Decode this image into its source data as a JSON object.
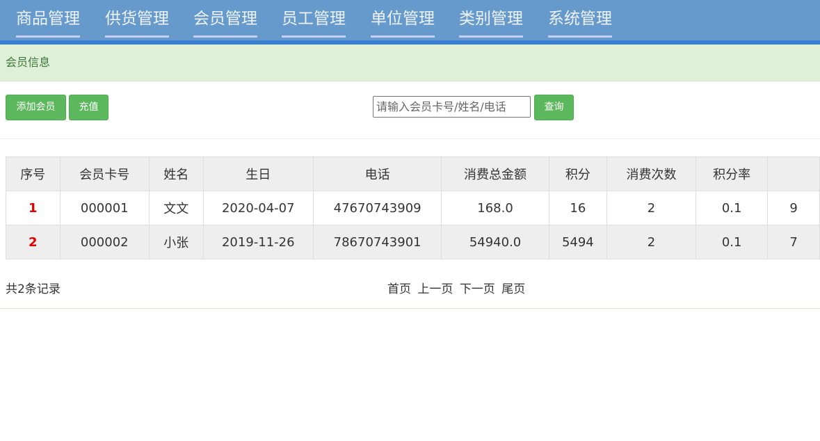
{
  "nav": {
    "items": [
      "商品管理",
      "供货管理",
      "会员管理",
      "员工管理",
      "单位管理",
      "类别管理",
      "系统管理"
    ]
  },
  "info_bar": {
    "title": "会员信息"
  },
  "toolbar": {
    "add_label": "添加会员",
    "recharge_label": "充值",
    "search_placeholder": "请输入会员卡号/姓名/电话",
    "search_value": "",
    "query_label": "查询"
  },
  "table": {
    "headers": [
      "序号",
      "会员卡号",
      "姓名",
      "生日",
      "电话",
      "消费总金额",
      "积分",
      "消费次数",
      "积分率",
      ""
    ],
    "rows": [
      [
        "1",
        "000001",
        "文文",
        "2020-04-07",
        "47670743909",
        "168.0",
        "16",
        "2",
        "0.1",
        "9"
      ],
      [
        "2",
        "000002",
        "小张",
        "2019-11-26",
        "78670743901",
        "54940.0",
        "5494",
        "2",
        "0.1",
        "7"
      ]
    ]
  },
  "footer": {
    "count_text": "共2条记录",
    "pager": {
      "first": "首页",
      "prev": "上一页",
      "next": "下一页",
      "last": "尾页"
    }
  },
  "colors": {
    "nav_bg": "#6699cc",
    "nav_border": "#3a7fd1",
    "info_bg": "#dff0d8",
    "info_text": "#3c763d",
    "btn_bg": "#5cb85c",
    "seq_text": "#e00000"
  }
}
